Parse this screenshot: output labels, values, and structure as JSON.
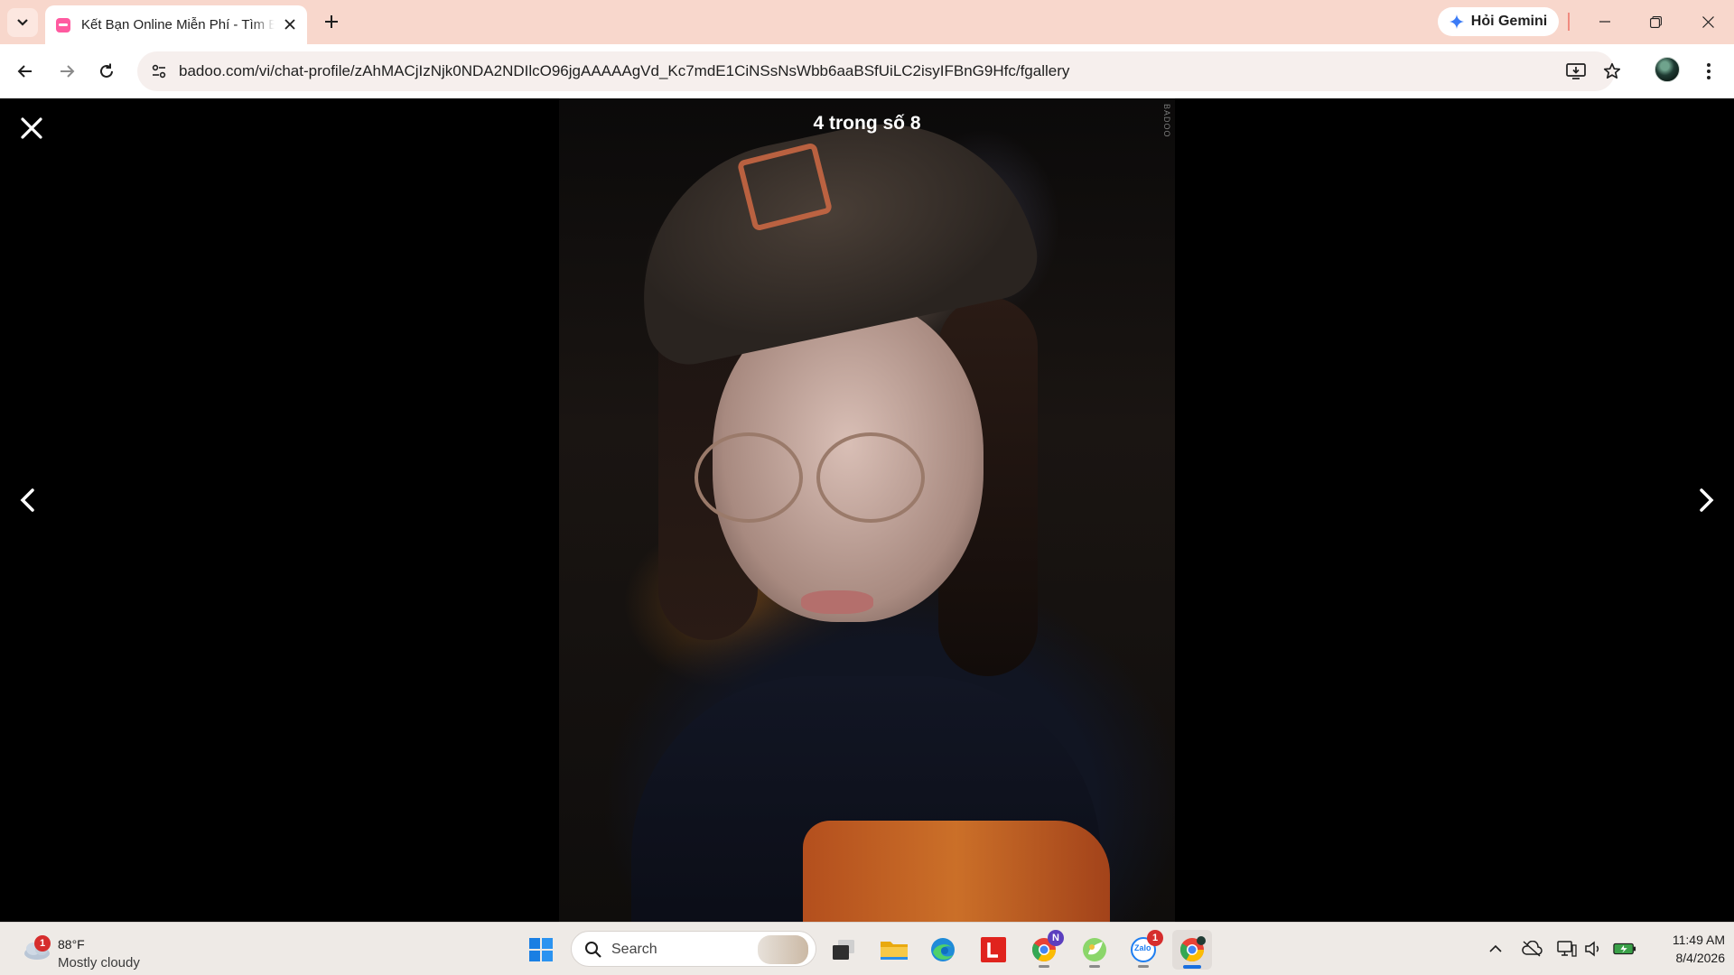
{
  "browser": {
    "tab_title": "Kết Bạn Online Miễn Phí - Tìm Bạn",
    "gemini_label": "Hỏi Gemini",
    "url": "badoo.com/vi/chat-profile/zAhMACjIzNjk0NDA2NDIlcO96jgAAAAAgVd_Kc7mdE1CiNSsNsWbb6aaBSfUiLC2isyIFBnG9Hfc/fgallery"
  },
  "viewer": {
    "counter": "4 trong số 8",
    "watermark": "BADOO"
  },
  "taskbar": {
    "weather_temp": "88°F",
    "weather_cond": "Mostly cloudy",
    "weather_badge": "1",
    "search_label": "Search",
    "chrome_profile_badge": "N",
    "zalo_badge": "1",
    "zalo_text": "Zalo",
    "time": "11:49 AM",
    "date": "8/4/2026"
  },
  "colors": {
    "tabstrip": "#f8d7cc",
    "viewer_bg": "#000000",
    "taskbar": "#eeeae6",
    "accent_blue": "#1a6fdf"
  }
}
